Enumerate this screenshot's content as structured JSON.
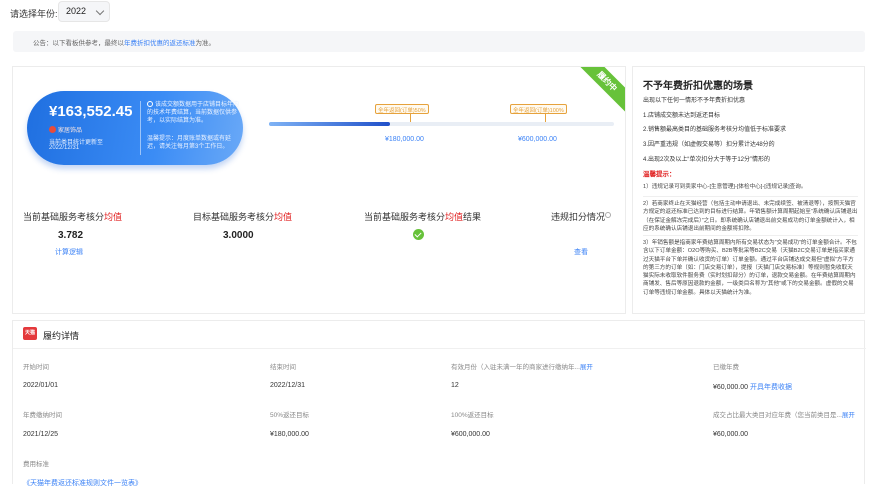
{
  "filter": {
    "label": "请选择年份:",
    "year": "2022"
  },
  "notice": {
    "prefix": "公告：以下看板供参考，最终以",
    "link": "年费折扣优惠的返还标准",
    "suffix": "为准。"
  },
  "summary": {
    "badge": "履约中",
    "amount": "¥163,552.45",
    "mark": "家居饰品",
    "sub1": "当前类目统计更新至",
    "sub2": "2022/12/31",
    "tip1": "该成交额数据用于店铺目标年内的技术年费结算，当前数据仅供参考，以实际结算为准。",
    "tip2": "温馨提示：月度账单数据或有延迟，请关注每月第3个工作日。",
    "progress_pct": 0.35,
    "flag1": {
      "label": "全年返回(订单)50%",
      "value": "¥180,000.00"
    },
    "flag2": {
      "label": "全年返回(订单)100%",
      "value": "¥600,000.00"
    }
  },
  "metrics": [
    {
      "title_a": "当前基础服务考核分",
      "title_b": "均值",
      "value": "3.782",
      "link": "计算逻辑"
    },
    {
      "title_a": "目标基础服务考核分",
      "title_b": "均值",
      "value": "3.0000"
    },
    {
      "title_a": "当前基础服务考核分",
      "title_b": "均值",
      "title_c": "结果"
    },
    {
      "title_a": "违规扣分情况",
      "link": "查看"
    }
  ],
  "rules": {
    "title": "不予年费折扣优惠的场景",
    "intro": "出现以下任何一情形不予年费折扣优惠",
    "items": [
      "1.店铺成交额未达到返还目标",
      "2.销售额最高类目的基础服务考核分均值低于标准要求",
      "3.因严重违规（如虚假交易等）扣分累计达48分的",
      "4.出现2次及以上“单次扣分大于等于12分”情形的"
    ],
    "warn": "温馨提示：",
    "para1": "1）违规记录可到卖家中心-[生意管理]-[体检中心]-[违规记录]查询。",
    "para2": "2）若商家终止在天猫经营（包括主动申请退出、未完成续签、被清退等），按照天猫官方规定的返还标准已达到的目标进行结算。年销售额计算周期起始至“系统确认店铺退出（在保证金解冻完成后）”之日。即系统确认店铺退出前交易成功的订单金额统计入，相应的系统确认店铺退出前期间的金额将扣除。",
    "para3": "3）年销售额是指商家年费结算周期内所有交易状态为“交易成功”的订单金额合计。不包含以下订单金额：O2O等购买、B2B等批采等B2C交易（天猫B2C交易订单是指买家通过天猫平台下单并确认收货的订单）订单金额。通过平台店铺达成交易但“虚拟”方平方的第三方的订单（如：门店交易订单），提报（天猫门店交易标准）等规则暂免收取天猫实际未收取软件服务费（实时划扣部分）的订单，退款交易金额。在年费结算周期内商铺发、售后等原因退款的金额，一级类目名称为“其他”或下的交易金额。虚假的交易订单等违规订单金额。具体以天猫统计为准。"
  },
  "detail": {
    "title": "履约详情",
    "logo": "天猫",
    "fields": [
      {
        "label": "开始时间",
        "value": "2022/01/01"
      },
      {
        "label": "结束时间",
        "value": "2022/12/31"
      },
      {
        "label": "有效月份（入驻未满一年的商家进行缴纳年...",
        "label_link": "展开",
        "value": "12"
      },
      {
        "label": "已缴年费",
        "value": "¥60,000.00",
        "value_link": "开具年费收据"
      },
      {
        "label": "年费缴纳时间",
        "value": "2021/12/25"
      },
      {
        "label": "50%返还目标",
        "value": "¥180,000.00"
      },
      {
        "label": "100%返还目标",
        "value": "¥600,000.00"
      },
      {
        "label": "成交占比最大类目对应年费（您当前类目是...",
        "label_link": "展开",
        "value": "¥60,000.00"
      }
    ],
    "std_label": "费用标准",
    "std_link": "《天猫年费返还标准规则文件一览表》"
  }
}
